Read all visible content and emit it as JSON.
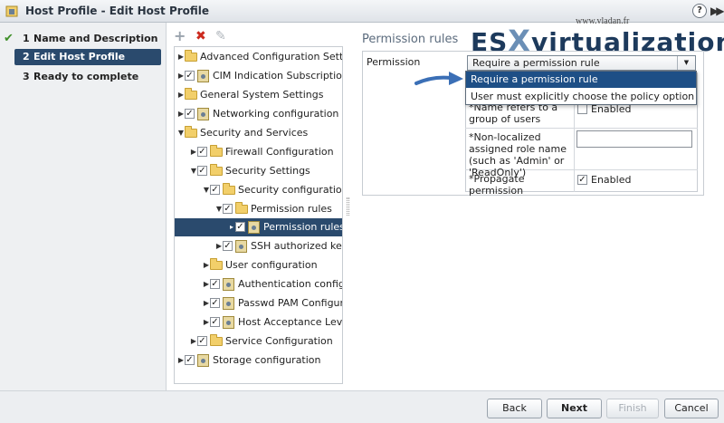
{
  "window": {
    "title": "Host Profile - Edit Host Profile",
    "help_label": "?",
    "forward_label": "▶▶"
  },
  "steps": [
    {
      "num": "1",
      "label": "Name and Description",
      "state": "done"
    },
    {
      "num": "2",
      "label": "Edit Host Profile",
      "state": "active"
    },
    {
      "num": "3",
      "label": "Ready to complete",
      "state": "pending"
    }
  ],
  "tree_toolbar": {
    "add": "+",
    "remove": "✖",
    "edit": "✎"
  },
  "tree": [
    {
      "label": "Advanced Configuration Settings",
      "checked": false,
      "icon": "folder",
      "expanded": false
    },
    {
      "label": "CIM Indication Subscriptions",
      "checked": true,
      "icon": "gear",
      "expanded": false
    },
    {
      "label": "General System Settings",
      "checked": false,
      "icon": "folder",
      "expanded": false
    },
    {
      "label": "Networking configuration",
      "checked": true,
      "icon": "gear",
      "expanded": false
    },
    {
      "label": "Security and Services",
      "checked": false,
      "icon": "folder",
      "expanded": true
    },
    {
      "label": "Firewall Configuration",
      "checked": true,
      "icon": "folder",
      "expanded": false
    },
    {
      "label": "Security Settings",
      "checked": true,
      "icon": "folder",
      "expanded": true
    },
    {
      "label": "Security configuration",
      "checked": true,
      "icon": "folder",
      "expanded": true
    },
    {
      "label": "Permission rules",
      "checked": true,
      "icon": "folder",
      "expanded": true
    },
    {
      "label": "Permission rules",
      "checked": true,
      "icon": "gear",
      "expanded": false,
      "selected": true
    },
    {
      "label": "SSH authorized key for",
      "checked": true,
      "icon": "gear",
      "expanded": false
    },
    {
      "label": "User configuration",
      "checked": false,
      "icon": "folder",
      "expanded": false
    },
    {
      "label": "Authentication configurati",
      "checked": true,
      "icon": "gear",
      "expanded": false
    },
    {
      "label": "Passwd PAM Configuratio",
      "checked": true,
      "icon": "gear",
      "expanded": false
    },
    {
      "label": "Host Acceptance Level Co",
      "checked": true,
      "icon": "gear",
      "expanded": false
    },
    {
      "label": "Service Configuration",
      "checked": true,
      "icon": "folder",
      "expanded": false
    },
    {
      "label": "Storage configuration",
      "checked": true,
      "icon": "gear",
      "expanded": false
    }
  ],
  "watermark": {
    "site": "www.vladan.fr",
    "logo_a": "ES",
    "logo_x": "X",
    "logo_b": "virtualization"
  },
  "panel": {
    "title": "Permission rules",
    "permission_label": "Permission",
    "select_value": "Require a permission rule",
    "dropdown_options": [
      "Require a permission rule",
      "User must explicitly choose the policy option"
    ],
    "fields": [
      {
        "label": "*Name refers to a group of users",
        "value": "Enabled"
      },
      {
        "label": "*Non-localized assigned role name (such as 'Admin' or 'ReadOnly')",
        "value": ""
      },
      {
        "label": "*Propagate permission",
        "value": "Enabled"
      }
    ]
  },
  "footer": {
    "back": "Back",
    "next": "Next",
    "finish": "Finish",
    "cancel": "Cancel"
  },
  "colors": {
    "accent": "#2a4a6d",
    "highlight": "#1e4f86",
    "check_green": "#3f8f29",
    "folder": "#f2cf6a",
    "arrow_blue": "#3b6fb6"
  }
}
